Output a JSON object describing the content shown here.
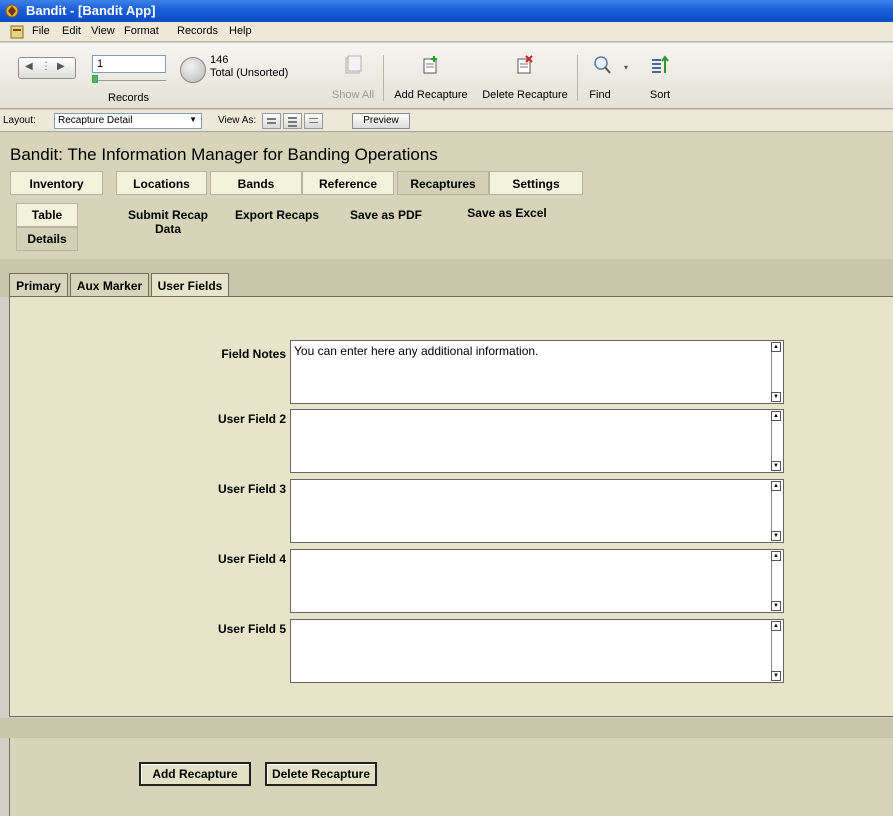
{
  "window": {
    "title": "Bandit - [Bandit App]"
  },
  "menu": [
    "File",
    "Edit",
    "View",
    "Format",
    "Records",
    "Help"
  ],
  "toolbar": {
    "record_number": "1",
    "records_label": "Records",
    "total_count": "146",
    "total_status": "Total (Unsorted)",
    "show_all": "Show All",
    "add_recapture": "Add Recapture",
    "delete_recapture": "Delete Recapture",
    "find": "Find",
    "sort": "Sort"
  },
  "layout_bar": {
    "layout_label": "Layout:",
    "layout_value": "Recapture Detail",
    "view_as_label": "View As:",
    "preview": "Preview"
  },
  "header": {
    "app_title": "Bandit: The Information Manager for Banding Operations",
    "nav_tabs": [
      "Inventory",
      "Locations",
      "Bands",
      "Reference",
      "Recaptures",
      "Settings"
    ],
    "active_tab": "Recaptures",
    "sub_buttons": {
      "table": "Table",
      "details": "Details"
    },
    "sub_links": {
      "submit_line1": "Submit Recap",
      "submit_line2": "Data",
      "export": "Export Recaps",
      "save_pdf": "Save as PDF",
      "save_excel": "Save as Excel"
    }
  },
  "record_tabs": [
    "Primary",
    "Aux Marker",
    "User Fields"
  ],
  "active_record_tab": "User Fields",
  "fields": [
    {
      "label": "Field Notes",
      "value": "You can enter here any additional information."
    },
    {
      "label": "User Field 2",
      "value": ""
    },
    {
      "label": "User Field 3",
      "value": ""
    },
    {
      "label": "User Field 4",
      "value": ""
    },
    {
      "label": "User Field 5",
      "value": ""
    }
  ],
  "footer": {
    "add_recapture": "Add Recapture",
    "delete_recapture": "Delete Recapture"
  },
  "colors": {
    "titlebar": "#1a5fd6",
    "header_bg": "#d6d5ba",
    "body_bg": "#e6e5ca"
  }
}
